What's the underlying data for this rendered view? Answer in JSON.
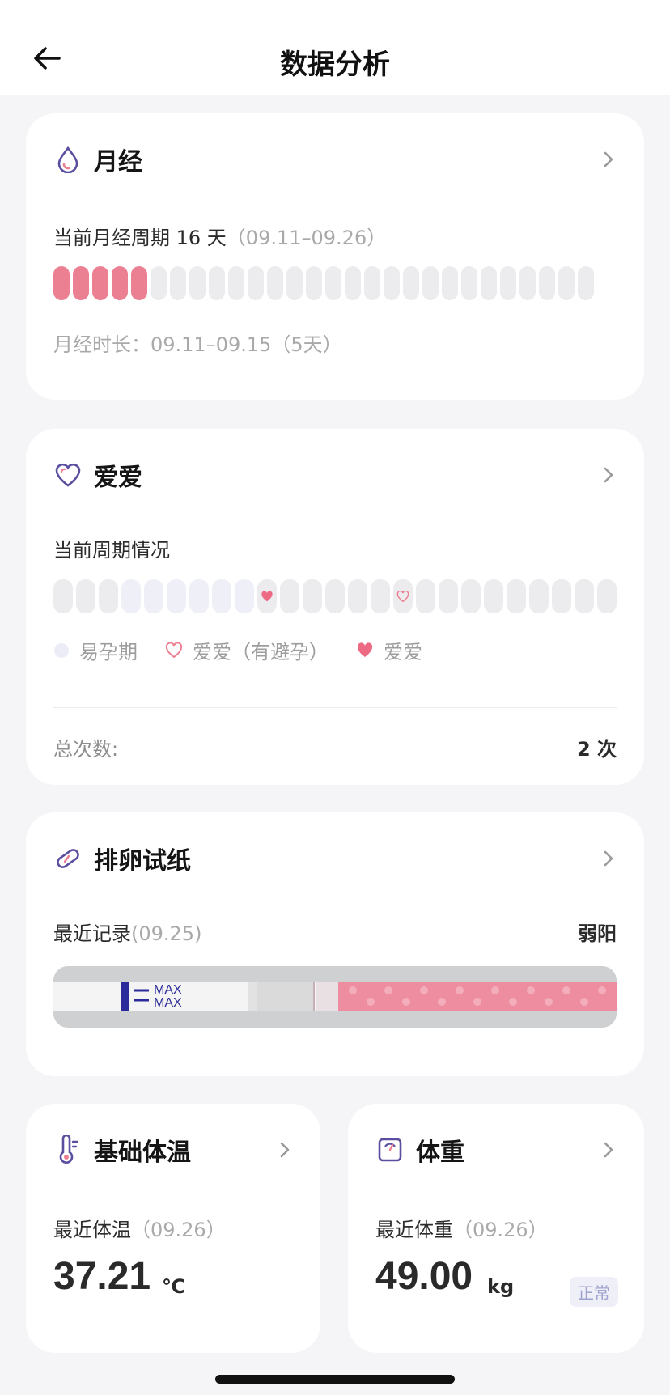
{
  "header": {
    "title": "数据分析"
  },
  "period": {
    "title": "月经",
    "cycle_prefix": "当前月经周期 16 天",
    "cycle_range": "（09.11–09.26）",
    "duration": "月经时长：09.11–09.15（5天）",
    "total_cells": 28,
    "period_days": 5
  },
  "love": {
    "title": "爱爱",
    "subtitle": "当前周期情况",
    "total_cells": 25,
    "fertile_days": [
      3,
      4,
      5,
      6,
      7,
      8
    ],
    "love_day": 9,
    "protected_day": 15,
    "legend": {
      "fertile": "易孕期",
      "protected": "爱爱（有避孕）",
      "love": "爱爱"
    },
    "total_label": "总次数:",
    "total_value": "2 次"
  },
  "ovulation": {
    "title": "排卵试纸",
    "recent_label": "最近记录",
    "recent_date": "(09.25)",
    "result": "弱阳",
    "strip_text_1": "MAX",
    "strip_text_2": "MAX"
  },
  "temperature": {
    "title": "基础体温",
    "recent_label": "最近体温",
    "recent_date": "（09.26）",
    "value": "37.21",
    "unit": "℃"
  },
  "weight": {
    "title": "体重",
    "recent_label": "最近体重",
    "recent_date": "（09.26）",
    "value": "49.00",
    "unit": "kg",
    "status": "正常"
  },
  "colors": {
    "accent": "#5a4f9f",
    "period_pink": "#ec8093",
    "fertile": "#efeff8"
  }
}
